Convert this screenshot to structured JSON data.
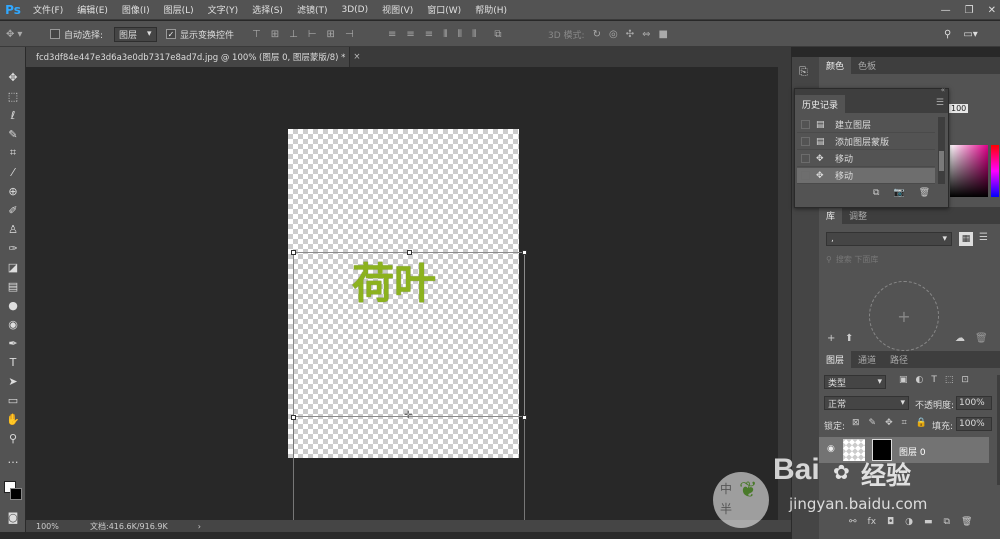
{
  "app": {
    "logo": "Ps"
  },
  "menu": [
    "文件(F)",
    "编辑(E)",
    "图像(I)",
    "图层(L)",
    "文字(Y)",
    "选择(S)",
    "滤镜(T)",
    "3D(D)",
    "视图(V)",
    "窗口(W)",
    "帮助(H)"
  ],
  "options": {
    "auto_select_label": "自动选择:",
    "auto_select_value": "图层",
    "show_transform_label": "显示变换控件",
    "mode3d_label": "3D 模式:"
  },
  "document": {
    "tab_title": "fcd3df84e447e3d6a3e0db7317e8ad7d.jpg @ 100% (图层 0, 图层蒙版/8) *",
    "close": "×",
    "canvas_text": "荷叶"
  },
  "status": {
    "zoom": "100%",
    "doc_info": "文档:416.6K/916.9K",
    "arrow": "›"
  },
  "panels": {
    "color_tabs": [
      "颜色",
      "色板"
    ],
    "color_value": "100",
    "library_tabs": [
      "库",
      "调整"
    ],
    "library_select": ",",
    "library_search": "搜索 下面库",
    "layers_tabs": [
      "图层",
      "通道",
      "路径"
    ],
    "layer_filter": "类型",
    "blend_mode": "正常",
    "opacity_label": "不透明度:",
    "opacity_value": "100%",
    "lock_label": "锁定:",
    "fill_label": "填充:",
    "fill_value": "100%",
    "layer_name": "图层 0"
  },
  "history": {
    "title": "历史记录",
    "items": [
      {
        "label": "建立图层",
        "icon": "doc-icon"
      },
      {
        "label": "添加图层蒙版",
        "icon": "doc-icon"
      },
      {
        "label": "移动",
        "icon": "move-icon"
      },
      {
        "label": "移动",
        "icon": "move-icon"
      }
    ]
  },
  "watermark": {
    "text": "Bai",
    "text2": "经验",
    "url": "jingyan.baidu.com",
    "badge1": "中",
    "badge2": "半"
  },
  "colors": {
    "ps_blue": "#31a8ff",
    "leaf_green": "#8cb21e"
  }
}
